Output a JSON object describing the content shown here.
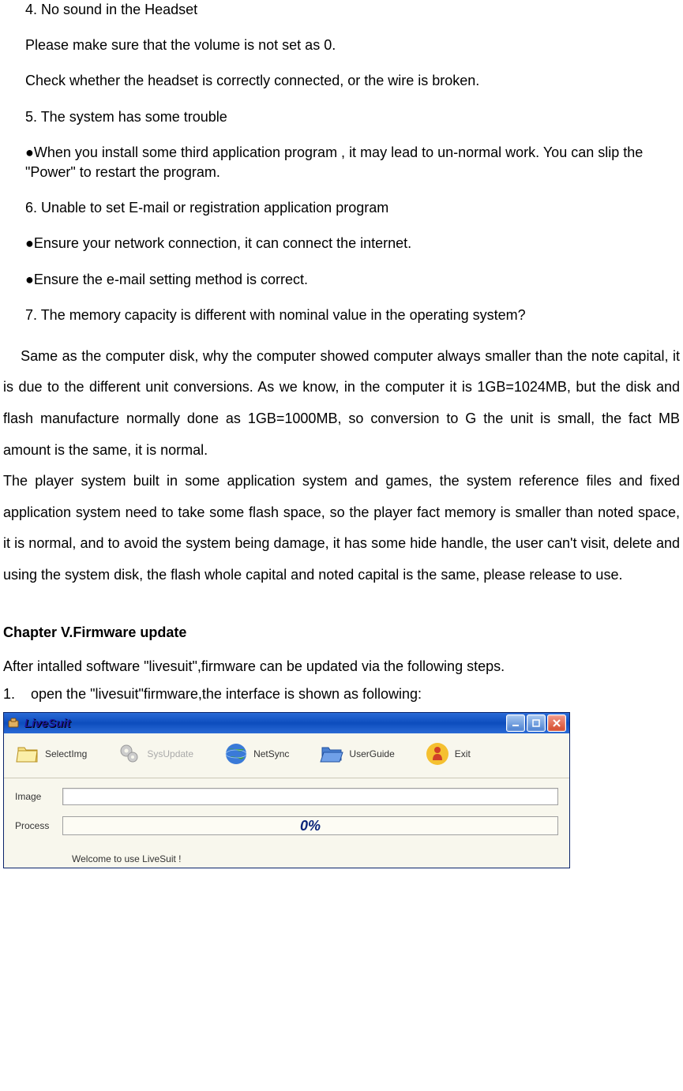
{
  "doc": {
    "q4_title": "4. No sound in the Headset",
    "q4_line1": "Please make sure that the volume is not set as 0.",
    "q4_line2": "Check whether the headset is correctly connected, or the wire is broken.",
    "q5_title": "5. The system has some trouble",
    "q5_bullet": "●When you install some third application program , it may lead to un-normal work. You can slip the \"Power\" to restart the program.",
    "q6_title": "6. Unable to set E-mail or registration application program",
    "q6_bullet1": "●Ensure your network connection, it can connect the internet.",
    "q6_bullet2": "●Ensure the e-mail setting method is correct.",
    "q7_title": "7. The memory capacity is different with nominal value in the operating system?",
    "q7_para1": "    Same as the computer disk, why the computer showed computer always smaller than the note capital, it is due to the different unit conversions. As we know, in the computer it is 1GB=1024MB, but the disk and flash manufacture normally done as 1GB=1000MB, so conversion to G the unit is small, the fact MB amount is the same, it is normal.",
    "q7_para2": "The player system built in some application system and games, the system reference files and fixed application system need to take some flash space, so the player fact memory is smaller than noted space, it is normal, and to avoid the system being damage, it has some hide handle, the user can't visit, delete and using the system disk, the flash whole capital and noted capital is the same, please release to use.",
    "chapter_title": "Chapter V.Firmware update",
    "chapter_intro": "After intalled software \"livesuit\",firmware can be updated via the following steps.",
    "step1": "1.    open the \"livesuit\"firmware,the interface is shown as following:"
  },
  "app": {
    "title": "LiveSuit",
    "toolbar": {
      "selectimg": "SelectImg",
      "sysupdate": "SysUpdate",
      "netsync": "NetSync",
      "userguide": "UserGuide",
      "exit": "Exit"
    },
    "image_label": "Image",
    "process_label": "Process",
    "progress": "0%",
    "status": "Welcome to use LiveSuit !"
  }
}
